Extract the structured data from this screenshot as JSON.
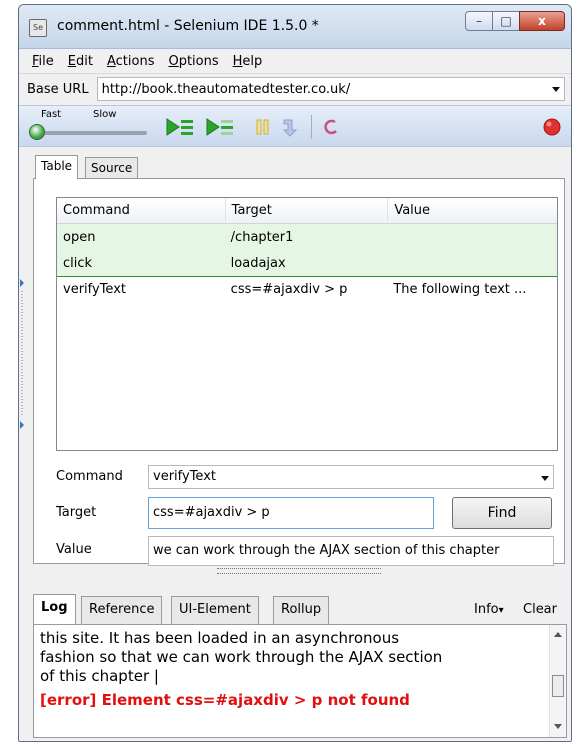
{
  "window": {
    "title": "comment.html - Selenium IDE 1.5.0 *",
    "app_icon_text": "Se",
    "minimize": "–",
    "maximize": "□",
    "close": "x"
  },
  "menu": [
    {
      "label": "File",
      "key": "F",
      "rest": "ile"
    },
    {
      "label": "Edit",
      "key": "E",
      "rest": "dit"
    },
    {
      "label": "Actions",
      "key": "A",
      "rest": "ctions"
    },
    {
      "label": "Options",
      "key": "O",
      "rest": "ptions"
    },
    {
      "label": "Help",
      "key": "H",
      "rest": "elp"
    }
  ],
  "base_url": {
    "label": "Base URL",
    "value": "http://book.theautomatedtester.co.uk/"
  },
  "toolbar": {
    "fast_label": "Fast",
    "slow_label": "Slow",
    "speed_level": "fast",
    "icons": [
      "play-all-icon",
      "play-current-icon",
      "pause-icon",
      "step-icon",
      "rollup-icon",
      "record-icon"
    ]
  },
  "editor_tabs": {
    "table": "Table",
    "source": "Source",
    "active": "Table"
  },
  "grid": {
    "headers": {
      "command": "Command",
      "target": "Target",
      "value": "Value"
    },
    "rows": [
      {
        "command": "open",
        "target": "/chapter1",
        "value": "",
        "state": "executed"
      },
      {
        "command": "click",
        "target": "loadajax",
        "value": "",
        "state": "executed"
      },
      {
        "command": "verifyText",
        "target": "css=#ajaxdiv > p",
        "value": "The following text ...",
        "state": "current"
      }
    ]
  },
  "form": {
    "command_label": "Command",
    "command_value": "verifyText",
    "target_label": "Target",
    "target_value": "css=#ajaxdiv > p",
    "find_label": "Find",
    "value_label": "Value",
    "value_value": "we can work through the AJAX section of this chapter"
  },
  "bottom_tabs": {
    "log": "Log",
    "reference": "Reference",
    "ui_element": "UI-Element",
    "rollup": "Rollup",
    "info": "Info",
    "info_arrow": "▾",
    "clear": "Clear",
    "active": "Log"
  },
  "log": {
    "lines": [
      "this site. It has been loaded in an asynchronous",
      "fashion so that we can work through the AJAX section",
      "of this chapter |"
    ],
    "error": "[error] Element css=#ajaxdiv > p not found"
  },
  "colors": {
    "executed_row": "#e5f6e5",
    "error_text": "#e01010",
    "play_green": "#2aa52a",
    "record_red": "#e03030"
  }
}
